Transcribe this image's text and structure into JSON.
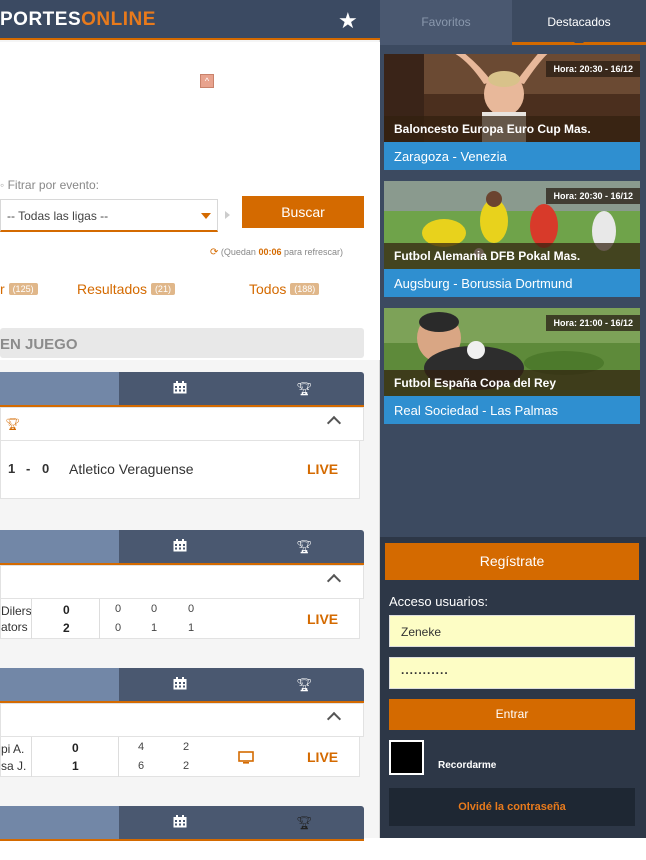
{
  "header": {
    "logo_main": "PORTES",
    "logo_accent": "ONLINE"
  },
  "filter": {
    "label": "Fitrar por evento:",
    "select_value": "-- Todas las ligas --",
    "button": "Buscar",
    "refresh_prefix": "(Quedan",
    "refresh_time": "00:06",
    "refresh_suffix": "para refrescar)"
  },
  "tabs": [
    {
      "label": "r",
      "count": "(125)"
    },
    {
      "label": "Resultados",
      "count": "(21)"
    },
    {
      "label": "Todos",
      "count": "(188)"
    }
  ],
  "section_title": "EN JUEGO",
  "live_label": "LIVE",
  "matches": {
    "m1": {
      "home_score": "1",
      "sep": "-",
      "away_score": "0",
      "away_team": "Atletico Veraguense"
    },
    "m2": {
      "team1": "Dilers",
      "team2": "ators",
      "t1_total": "0",
      "t2_total": "2",
      "t1_sets": [
        "0",
        "0",
        "0"
      ],
      "t2_sets": [
        "0",
        "1",
        "1"
      ]
    },
    "m3": {
      "team1": "pi A.",
      "team2": "sa J.",
      "t1_total": "0",
      "t2_total": "1",
      "t1_sets": [
        "4",
        "2"
      ],
      "t2_sets": [
        "6",
        "2"
      ]
    }
  },
  "sidebar": {
    "tab_favoritos": "Favoritos",
    "tab_destacados": "Destacados",
    "featured": [
      {
        "time": "Hora: 20:30 - 16/12",
        "league": "Baloncesto Europa Euro Cup Mas.",
        "match": "Zaragoza - Venezia"
      },
      {
        "time": "Hora: 20:30 - 16/12",
        "league": "Futbol Alemania DFB Pokal Mas.",
        "match": "Augsburg - Borussia Dortmund"
      },
      {
        "time": "Hora: 21:00 - 16/12",
        "league": "Futbol España Copa del Rey",
        "match": "Real Sociedad - Las Palmas"
      }
    ],
    "register": "Regístrate",
    "login": {
      "title": "Acceso usuarios:",
      "username": "Zeneke",
      "password": "...........",
      "submit": "Entrar",
      "remember": "Recordarme",
      "forgot": "Olvidé la contraseña"
    }
  }
}
